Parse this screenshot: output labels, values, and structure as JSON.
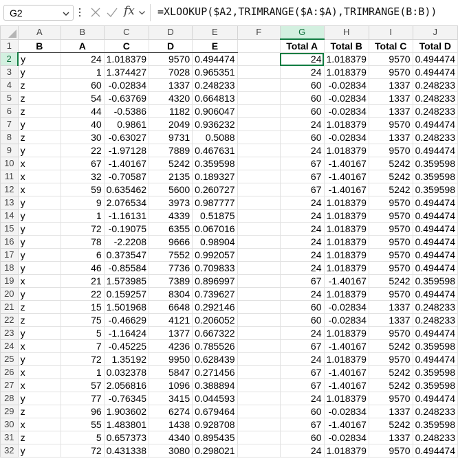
{
  "formula_bar": {
    "name_box": "G2",
    "formula": "=XLOOKUP($A2,TRIMRANGE($A:$A),TRIMRANGE(B:B))"
  },
  "colors": {
    "accent": "#107c41",
    "selected_header_bg": "#d3f0e0"
  },
  "columns": [
    "A",
    "B",
    "C",
    "D",
    "E",
    "F",
    "G",
    "H",
    "I",
    "J"
  ],
  "row_numbers": [
    "1",
    "2",
    "3",
    "4",
    "5",
    "6",
    "7",
    "8",
    "9",
    "10",
    "11",
    "12",
    "13",
    "14",
    "15",
    "16",
    "17",
    "18",
    "19",
    "20",
    "21",
    "22",
    "23",
    "24",
    "25",
    "26",
    "27",
    "28",
    "29",
    "30",
    "31",
    "32"
  ],
  "source_headers": [
    "B",
    "A",
    "C",
    "D",
    "E"
  ],
  "result_headers": [
    "Total A",
    "Total B",
    "Total C",
    "Total D"
  ],
  "source_rows": [
    [
      "y",
      "24",
      "1.018379",
      "9570",
      "0.494474"
    ],
    [
      "y",
      "1",
      "1.374427",
      "7028",
      "0.965351"
    ],
    [
      "z",
      "60",
      "-0.02834",
      "1337",
      "0.248233"
    ],
    [
      "z",
      "54",
      "-0.63769",
      "4320",
      "0.664813"
    ],
    [
      "z",
      "44",
      "-0.5386",
      "1182",
      "0.906047"
    ],
    [
      "y",
      "40",
      "0.9861",
      "2049",
      "0.936232"
    ],
    [
      "z",
      "30",
      "-0.63027",
      "9731",
      "0.5088"
    ],
    [
      "y",
      "22",
      "-1.97128",
      "7889",
      "0.467631"
    ],
    [
      "x",
      "67",
      "-1.40167",
      "5242",
      "0.359598"
    ],
    [
      "x",
      "32",
      "-0.70587",
      "2135",
      "0.189327"
    ],
    [
      "x",
      "59",
      "0.635462",
      "5600",
      "0.260727"
    ],
    [
      "y",
      "9",
      "2.076534",
      "3973",
      "0.987777"
    ],
    [
      "y",
      "1",
      "-1.16131",
      "4339",
      "0.51875"
    ],
    [
      "y",
      "72",
      "-0.19075",
      "6355",
      "0.067016"
    ],
    [
      "y",
      "78",
      "-2.2208",
      "9666",
      "0.98904"
    ],
    [
      "y",
      "6",
      "0.373547",
      "7552",
      "0.992057"
    ],
    [
      "y",
      "46",
      "-0.85584",
      "7736",
      "0.709833"
    ],
    [
      "x",
      "21",
      "1.573985",
      "7389",
      "0.896997"
    ],
    [
      "y",
      "22",
      "0.159257",
      "8304",
      "0.739627"
    ],
    [
      "z",
      "15",
      "1.501968",
      "6648",
      "0.292146"
    ],
    [
      "z",
      "75",
      "-0.46629",
      "4121",
      "0.206052"
    ],
    [
      "y",
      "5",
      "-1.16424",
      "1377",
      "0.667322"
    ],
    [
      "x",
      "7",
      "-0.45225",
      "4236",
      "0.785526"
    ],
    [
      "y",
      "72",
      "1.35192",
      "9950",
      "0.628439"
    ],
    [
      "x",
      "1",
      "0.032378",
      "5847",
      "0.271456"
    ],
    [
      "x",
      "57",
      "2.056816",
      "1096",
      "0.388894"
    ],
    [
      "y",
      "77",
      "-0.76345",
      "3415",
      "0.044593"
    ],
    [
      "z",
      "96",
      "1.903602",
      "6274",
      "0.679464"
    ],
    [
      "x",
      "55",
      "1.483801",
      "1438",
      "0.928708"
    ],
    [
      "z",
      "5",
      "0.657373",
      "4340",
      "0.895435"
    ],
    [
      "y",
      "72",
      "0.431338",
      "3080",
      "0.298021"
    ]
  ],
  "result_rows": [
    [
      "24",
      "1.018379",
      "9570",
      "0.494474"
    ],
    [
      "24",
      "1.018379",
      "9570",
      "0.494474"
    ],
    [
      "60",
      "-0.02834",
      "1337",
      "0.248233"
    ],
    [
      "60",
      "-0.02834",
      "1337",
      "0.248233"
    ],
    [
      "60",
      "-0.02834",
      "1337",
      "0.248233"
    ],
    [
      "24",
      "1.018379",
      "9570",
      "0.494474"
    ],
    [
      "60",
      "-0.02834",
      "1337",
      "0.248233"
    ],
    [
      "24",
      "1.018379",
      "9570",
      "0.494474"
    ],
    [
      "67",
      "-1.40167",
      "5242",
      "0.359598"
    ],
    [
      "67",
      "-1.40167",
      "5242",
      "0.359598"
    ],
    [
      "67",
      "-1.40167",
      "5242",
      "0.359598"
    ],
    [
      "24",
      "1.018379",
      "9570",
      "0.494474"
    ],
    [
      "24",
      "1.018379",
      "9570",
      "0.494474"
    ],
    [
      "24",
      "1.018379",
      "9570",
      "0.494474"
    ],
    [
      "24",
      "1.018379",
      "9570",
      "0.494474"
    ],
    [
      "24",
      "1.018379",
      "9570",
      "0.494474"
    ],
    [
      "24",
      "1.018379",
      "9570",
      "0.494474"
    ],
    [
      "67",
      "-1.40167",
      "5242",
      "0.359598"
    ],
    [
      "24",
      "1.018379",
      "9570",
      "0.494474"
    ],
    [
      "60",
      "-0.02834",
      "1337",
      "0.248233"
    ],
    [
      "60",
      "-0.02834",
      "1337",
      "0.248233"
    ],
    [
      "24",
      "1.018379",
      "9570",
      "0.494474"
    ],
    [
      "67",
      "-1.40167",
      "5242",
      "0.359598"
    ],
    [
      "24",
      "1.018379",
      "9570",
      "0.494474"
    ],
    [
      "67",
      "-1.40167",
      "5242",
      "0.359598"
    ],
    [
      "67",
      "-1.40167",
      "5242",
      "0.359598"
    ],
    [
      "24",
      "1.018379",
      "9570",
      "0.494474"
    ],
    [
      "60",
      "-0.02834",
      "1337",
      "0.248233"
    ],
    [
      "67",
      "-1.40167",
      "5242",
      "0.359598"
    ],
    [
      "60",
      "-0.02834",
      "1337",
      "0.248233"
    ],
    [
      "24",
      "1.018379",
      "9570",
      "0.494474"
    ]
  ],
  "selection": {
    "cell": "G2",
    "column": "G",
    "row": "2"
  }
}
